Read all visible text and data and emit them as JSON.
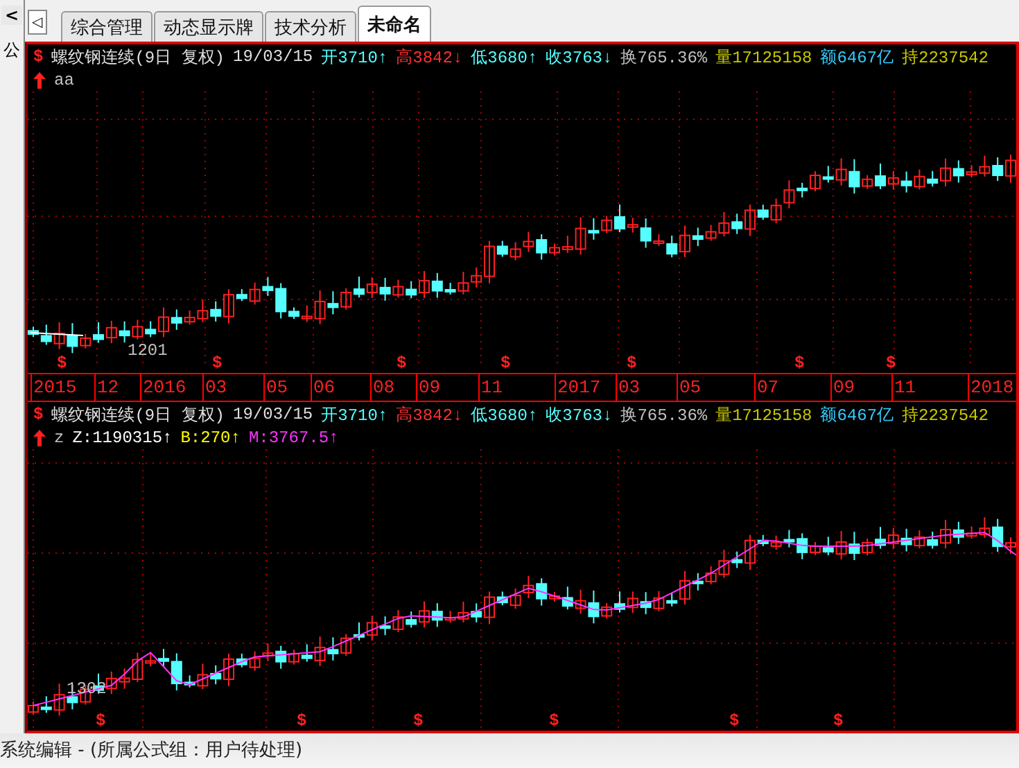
{
  "left_panel": {
    "button": "<",
    "label": "公"
  },
  "tab_bar": {
    "scroll_button": "◁",
    "tabs": [
      {
        "label": "综合管理",
        "selected": false
      },
      {
        "label": "动态显示牌",
        "selected": false
      },
      {
        "label": "技术分析",
        "selected": false
      },
      {
        "label": "未命名",
        "selected": true
      }
    ]
  },
  "upper_panel": {
    "symbol_mark": "$",
    "quote": [
      {
        "text": "螺纹钢连续(9日 复权)",
        "color": "#e0e0e0"
      },
      {
        "text": "19/03/15",
        "color": "#e0e0e0"
      },
      {
        "text": "开3710↑",
        "color": "#55ffff"
      },
      {
        "text": "高3842↓",
        "color": "#ff3030"
      },
      {
        "text": "低3680↑",
        "color": "#55ffff"
      },
      {
        "text": "收3763↓",
        "color": "#55ffff"
      },
      {
        "text": "换765.36%",
        "color": "#c0c0c0"
      },
      {
        "text": "量17125158",
        "color": "#c8c800"
      },
      {
        "text": "额6467亿",
        "color": "#33ccff"
      },
      {
        "text": "持2237542",
        "color": "#c8c800"
      }
    ],
    "indicator": [
      {
        "text": "aa",
        "color": "#c0c0c0"
      }
    ],
    "low_label": "1201",
    "signal_marks": [
      "$",
      "$",
      "$",
      "$",
      "$",
      "$",
      "$"
    ]
  },
  "time_axis": [
    "2015",
    "12",
    "2016",
    "03",
    "05",
    "06",
    "08",
    "09",
    "11",
    "2017",
    "03",
    "05",
    "07",
    "09",
    "11",
    "2018"
  ],
  "lower_panel": {
    "symbol_mark": "$",
    "quote": [
      {
        "text": "螺纹钢连续(9日 复权)",
        "color": "#e0e0e0"
      },
      {
        "text": "19/03/15",
        "color": "#e0e0e0"
      },
      {
        "text": "开3710↑",
        "color": "#55ffff"
      },
      {
        "text": "高3842↓",
        "color": "#ff3030"
      },
      {
        "text": "低3680↑",
        "color": "#55ffff"
      },
      {
        "text": "收3763↓",
        "color": "#55ffff"
      },
      {
        "text": "换765.36%",
        "color": "#c0c0c0"
      },
      {
        "text": "量17125158",
        "color": "#c8c800"
      },
      {
        "text": "额6467亿",
        "color": "#33ccff"
      },
      {
        "text": "持2237542",
        "color": "#c8c800"
      }
    ],
    "indicator": [
      {
        "text": "z",
        "color": "#c0c0c0"
      },
      {
        "text": "Z:1190315↑",
        "color": "#ffffff"
      },
      {
        "text": "B:270↑",
        "color": "#ffff00"
      },
      {
        "text": "M:3767.5↑",
        "color": "#ff33ff"
      }
    ],
    "low_label": "1302",
    "signal_marks": [
      "$",
      "$",
      "$",
      "$",
      "$",
      "$"
    ]
  },
  "status_bar": {
    "text": "系统编辑 - (所属公式组：用户待处理)"
  }
}
